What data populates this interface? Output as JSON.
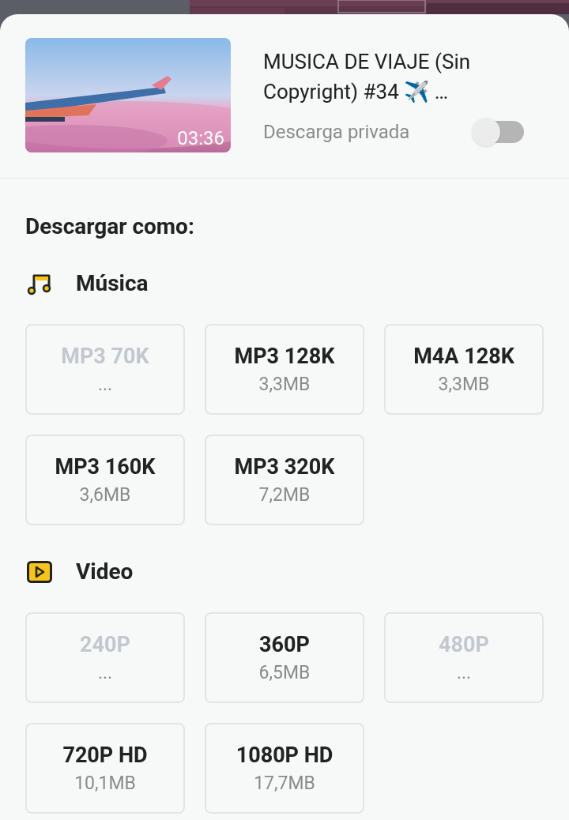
{
  "video": {
    "duration": "03:36",
    "title": "MUSICA DE VIAJE (Sin Copyright) #34 ✈️ …"
  },
  "private_download": {
    "label": "Descarga privada",
    "on": false
  },
  "heading": "Descargar como:",
  "sections": [
    {
      "kind": "music",
      "title": "Música",
      "formats": [
        {
          "label": "MP3 70K",
          "size": "...",
          "disabled": true
        },
        {
          "label": "MP3 128K",
          "size": "3,3MB",
          "disabled": false
        },
        {
          "label": "M4A 128K",
          "size": "3,3MB",
          "disabled": false
        },
        {
          "label": "MP3 160K",
          "size": "3,6MB",
          "disabled": false
        },
        {
          "label": "MP3 320K",
          "size": "7,2MB",
          "disabled": false
        }
      ]
    },
    {
      "kind": "video",
      "title": "Video",
      "formats": [
        {
          "label": "240P",
          "size": "...",
          "disabled": true
        },
        {
          "label": "360P",
          "size": "6,5MB",
          "disabled": false
        },
        {
          "label": "480P",
          "size": "...",
          "disabled": true
        },
        {
          "label": "720P HD",
          "size": "10,1MB",
          "disabled": false
        },
        {
          "label": "1080P HD",
          "size": "17,7MB",
          "disabled": false
        }
      ]
    }
  ]
}
